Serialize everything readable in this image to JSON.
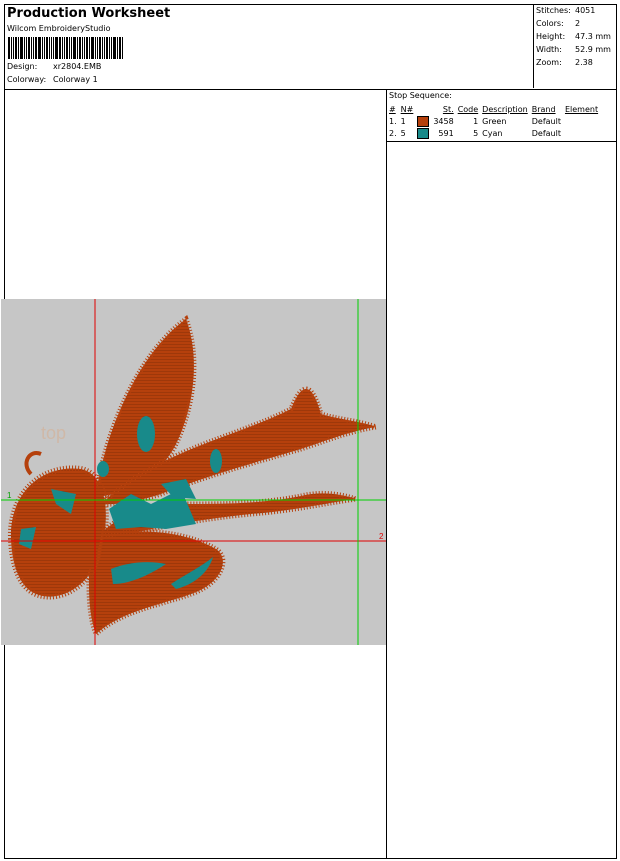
{
  "header": {
    "title": "Production Worksheet",
    "software": "Wilcom EmbroideryStudio",
    "design_label": "Design:",
    "design_value": "xr2804.EMB",
    "colorway_label": "Colorway:",
    "colorway_value": "Colorway 1"
  },
  "stats": [
    {
      "label": "Stitches:",
      "value": "4051"
    },
    {
      "label": "Colors:",
      "value": "2"
    },
    {
      "label": "Height:",
      "value": "47.3 mm"
    },
    {
      "label": "Width:",
      "value": "52.9 mm"
    },
    {
      "label": "Zoom:",
      "value": "2.38"
    }
  ],
  "stop_sequence": {
    "title": "Stop Sequence:",
    "columns": [
      "#",
      "N#",
      "St.",
      "Code",
      "Description",
      "Brand",
      "Element"
    ],
    "rows": [
      {
        "idx": "1.",
        "n": "1",
        "color": "#b5400c",
        "stitches": "3458",
        "code": "1",
        "description": "Green",
        "brand": "Default",
        "element": ""
      },
      {
        "idx": "2.",
        "n": "5",
        "color": "#188a8a",
        "stitches": "591",
        "code": "5",
        "description": "Cyan",
        "brand": "Default",
        "element": ""
      }
    ]
  },
  "preview": {
    "background": "#c6c6c6",
    "fill_color": "#b5400c",
    "accent_color": "#188a8a",
    "guide_red": "#e00000",
    "guide_green": "#00d000",
    "marker_1": "1",
    "marker_2": "2"
  }
}
